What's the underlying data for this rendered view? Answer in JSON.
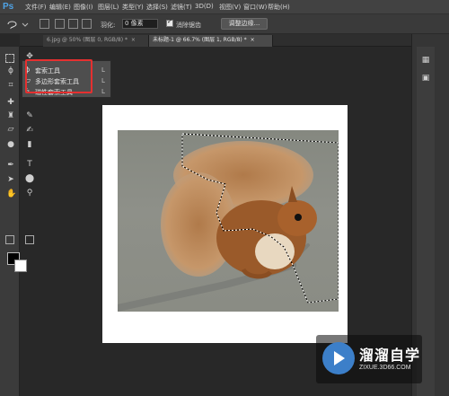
{
  "app": {
    "logo": "Ps"
  },
  "menu": [
    "文件(F)",
    "编辑(E)",
    "图像(I)",
    "图层(L)",
    "类型(Y)",
    "选择(S)",
    "滤镜(T)",
    "3D(D)",
    "视图(V)",
    "窗口(W)",
    "帮助(H)"
  ],
  "options": {
    "feather_label": "羽化:",
    "feather_value": "0 像素",
    "antialias_label": "消除锯齿",
    "refine_button": "调整边缘..."
  },
  "tabs": [
    {
      "label": "6.jpg @ 50% (图层 0, RGB/8) *",
      "close": "×"
    },
    {
      "label": "未标题-1 @ 66.7% (图层 1, RGB/8) *",
      "close": "×"
    }
  ],
  "lasso_menu": [
    {
      "label": "套索工具",
      "key": "L"
    },
    {
      "label": "多边形套索工具",
      "key": "L"
    },
    {
      "label": "磁性套索工具",
      "key": "L"
    }
  ],
  "watermark": {
    "title": "溜溜自学",
    "url": "ZIXUE.3D66.COM"
  },
  "colors": {
    "foreground": "#000000",
    "background": "#ffffff",
    "highlight": "#e53030",
    "accent": "#4fa3e6"
  }
}
